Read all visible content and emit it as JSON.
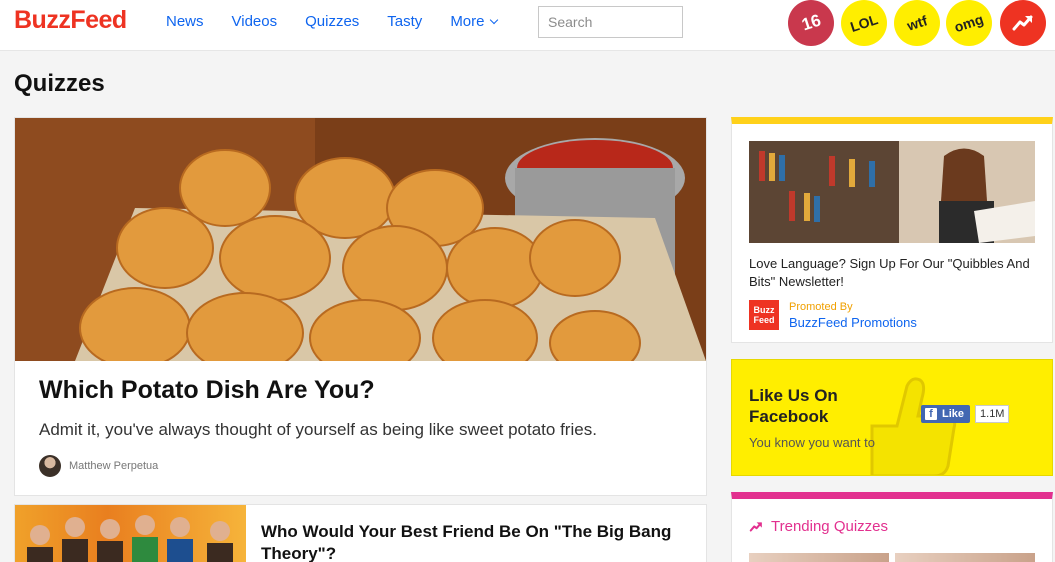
{
  "header": {
    "logo": "BuzzFeed",
    "nav": [
      "News",
      "Videos",
      "Quizzes",
      "Tasty",
      "More"
    ],
    "search_placeholder": "Search",
    "badges": {
      "count16": "16",
      "lol": "LOL",
      "wtf": "wtf",
      "omg": "omg",
      "trending_icon": "trending-arrow-icon"
    }
  },
  "page": {
    "title": "Quizzes"
  },
  "feature": {
    "title": "Which Potato Dish Are You?",
    "description": "Admit it, you've always thought of yourself as being like sweet potato fries.",
    "author": "Matthew Perpetua"
  },
  "card2": {
    "title": "Who Would Your Best Friend Be On \"The Big Bang Theory\"?"
  },
  "sidebar": {
    "promo": {
      "title": "Love Language? Sign Up For Our \"Quibbles And Bits\" Newsletter!",
      "promoted_label": "Promoted By",
      "promoted_name": "BuzzFeed Promotions",
      "mini_logo_top": "Buzz",
      "mini_logo_bottom": "Feed"
    },
    "facebook": {
      "title": "Like Us On Facebook",
      "subtitle": "You know you want to",
      "like_label": "Like",
      "like_count": "1.1M"
    },
    "trending": {
      "heading": "Trending Quizzes"
    }
  },
  "colors": {
    "brand_red": "#ee3322",
    "link_blue": "#0f65ef",
    "yellow": "#ffee00",
    "pink": "#e2308f"
  }
}
